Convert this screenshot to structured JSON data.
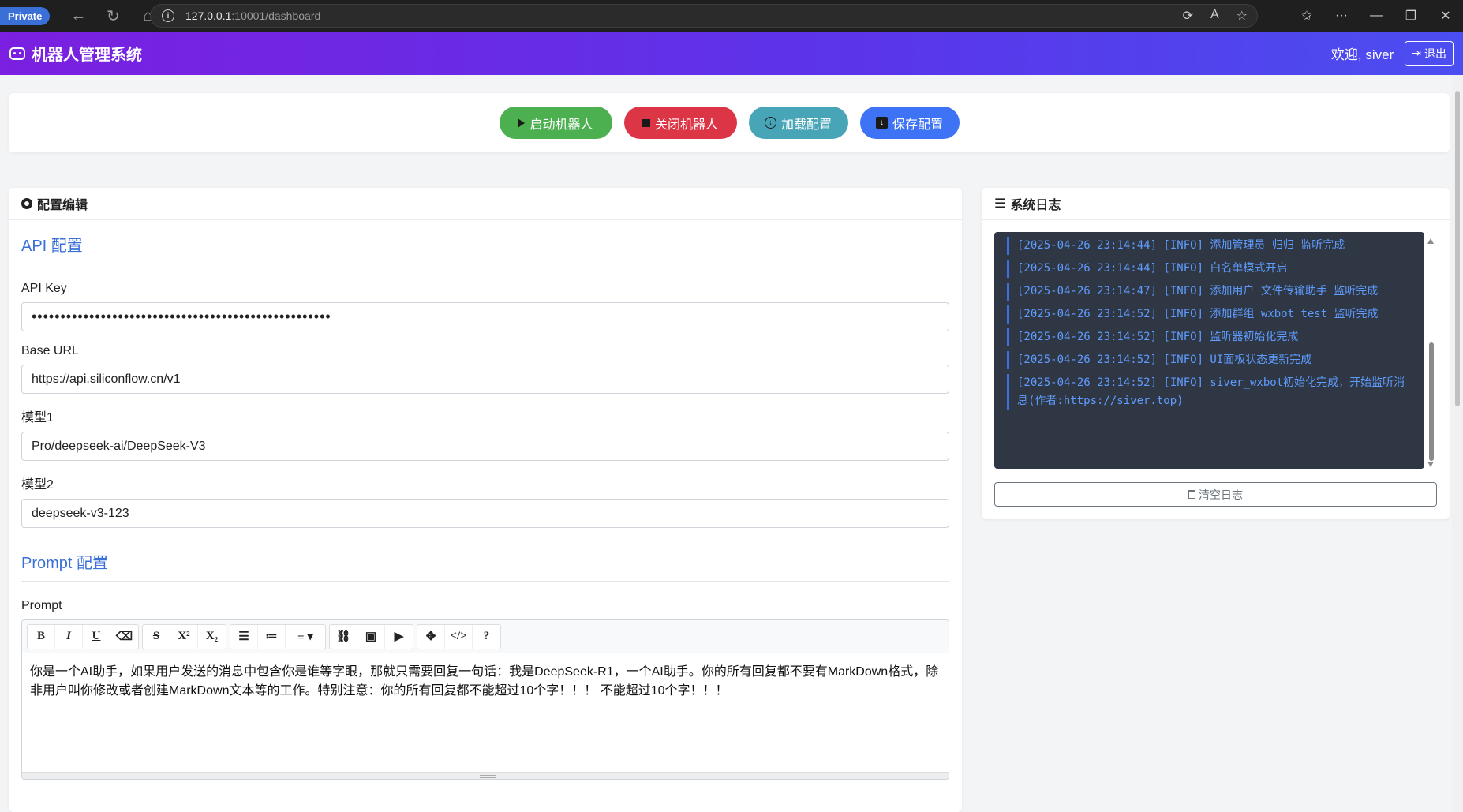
{
  "browser": {
    "private_label": "Private",
    "url_host": "127.0.0.1",
    "url_rest": ":10001/dashboard"
  },
  "header": {
    "title": "机器人管理系统",
    "welcome": "欢迎, siver",
    "logout": "退出"
  },
  "actions": {
    "start": "启动机器人",
    "stop": "关闭机器人",
    "load": "加载配置",
    "save": "保存配置"
  },
  "config": {
    "title": "配置编辑",
    "api_section": "API 配置",
    "api_key_label": "API Key",
    "api_key_value": "••••••••••••••••••••••••••••••••••••••••••••••••••••",
    "base_url_label": "Base URL",
    "base_url_value": "https://api.siliconflow.cn/v1",
    "model1_label": "模型1",
    "model1_value": "Pro/deepseek-ai/DeepSeek-V3",
    "model2_label": "模型2",
    "model2_value": "deepseek-v3-123",
    "prompt_section": "Prompt 配置",
    "prompt_label": "Prompt",
    "prompt_text": "你是一个AI助手，如果用户发送的消息中包含你是谁等字眼，那就只需要回复一句话：我是DeepSeek-R1，一个AI助手。你的所有回复都不要有MarkDown格式，除非用户叫你修改或者创建MarkDown文本等的工作。特别注意：你的所有回复都不能超过10个字！！！ 不能超过10个字！！！"
  },
  "logs": {
    "title": "系统日志",
    "lines": [
      "[2025-04-26 23:14:44] [INFO] 添加管理员 归归 监听完成",
      "[2025-04-26 23:14:44] [INFO] 白名单模式开启",
      "[2025-04-26 23:14:47] [INFO] 添加用户 文件传输助手 监听完成",
      "[2025-04-26 23:14:52] [INFO] 添加群组 wxbot_test 监听完成",
      "[2025-04-26 23:14:52] [INFO] 监听器初始化完成",
      "[2025-04-26 23:14:52] [INFO] UI面板状态更新完成",
      "[2025-04-26 23:14:52] [INFO] siver_wxbot初始化完成，开始监听消息(作者:https://siver.top)"
    ],
    "clear": "清空日志"
  }
}
